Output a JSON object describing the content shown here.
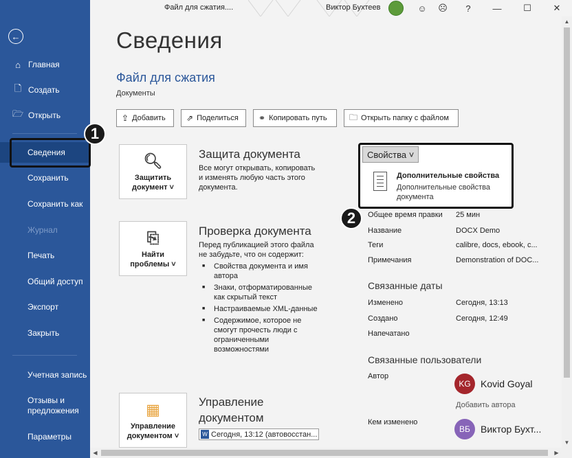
{
  "window": {
    "file_name": "Файл для сжатия....",
    "user_name": "Виктор Бухтеев",
    "buttons": {
      "smile": "☺",
      "frown": "☹",
      "help": "?",
      "minimize": "—",
      "restore": "☐",
      "close": "✕"
    }
  },
  "sidebar": {
    "back_icon": "←",
    "items": [
      {
        "label": "Главная",
        "icon": "⌂"
      },
      {
        "label": "Создать",
        "icon": "🗋"
      },
      {
        "label": "Открыть",
        "icon": "🗁"
      },
      {
        "label": "Сведения"
      },
      {
        "label": "Сохранить"
      },
      {
        "label": "Сохранить как"
      },
      {
        "label": "Журнал"
      },
      {
        "label": "Печать"
      },
      {
        "label": "Общий доступ"
      },
      {
        "label": "Экспорт"
      },
      {
        "label": "Закрыть"
      },
      {
        "label": "Учетная запись"
      },
      {
        "label": "Отзывы и предложения"
      },
      {
        "label": "Параметры"
      }
    ]
  },
  "main": {
    "title": "Сведения",
    "file_title": "Файл для сжатия",
    "file_path": "Документы",
    "actions": [
      {
        "label": "Добавить",
        "icon": "⇪"
      },
      {
        "label": "Поделиться",
        "icon": "⇗"
      },
      {
        "label": "Копировать путь",
        "icon": "⚭"
      },
      {
        "label": "Открыть папку с файлом",
        "icon": "🗀"
      }
    ],
    "protect": {
      "button_l1": "Защитить",
      "button_l2": "документ ˅",
      "title": "Защита документа",
      "text": "Все могут открывать, копировать и изменять любую часть этого документа."
    },
    "inspect": {
      "button_l1": "Найти",
      "button_l2": "проблемы ˅",
      "title": "Проверка документа",
      "text": "Перед публикацией этого файла не забудьте, что он содержит:",
      "bullets": [
        "Свойства документа и имя автора",
        "Знаки, отформатированные как скрытый текст",
        "Настраиваемые XML-данные",
        "Содержимое, которое не смогут прочесть люди с ограниченными возможностями"
      ]
    },
    "manage": {
      "button_l1": "Управление",
      "button_l2": "документом ˅",
      "title_l1": "Управление",
      "title_l2": "документом",
      "version": "Сегодня, 13:12 (автовосстан..."
    }
  },
  "properties": {
    "button": "Свойства ˅",
    "menu": {
      "title": "Дополнительные свойства",
      "description": "Дополнительные свойства документа"
    },
    "rows": [
      {
        "label": "Общее время правки",
        "value": "25 мин"
      },
      {
        "label": "Название",
        "value": "DOCX Demo"
      },
      {
        "label": "Теги",
        "value": "calibre, docs, ebook, c..."
      },
      {
        "label": "Примечания",
        "value": "Demonstration of DOC..."
      }
    ],
    "dates_title": "Связанные даты",
    "dates": [
      {
        "label": "Изменено",
        "value": "Сегодня, 13:13"
      },
      {
        "label": "Создано",
        "value": "Сегодня, 12:49"
      },
      {
        "label": "Напечатано",
        "value": ""
      }
    ],
    "people_title": "Связанные пользователи",
    "author_label": "Автор",
    "author_initials": "KG",
    "author_name": "Kovid Goyal",
    "add_author": "Добавить автора",
    "modified_by_label": "Кем изменено",
    "modifier_initials": "ВБ",
    "modifier_name": "Виктор Бухт...",
    "colors": {
      "author": "#a4262c",
      "modifier": "#8764b8"
    }
  },
  "badges": {
    "one": "1",
    "two": "2"
  },
  "colors": {
    "sidebar": "#2b579a",
    "accent": "#2b579a"
  }
}
